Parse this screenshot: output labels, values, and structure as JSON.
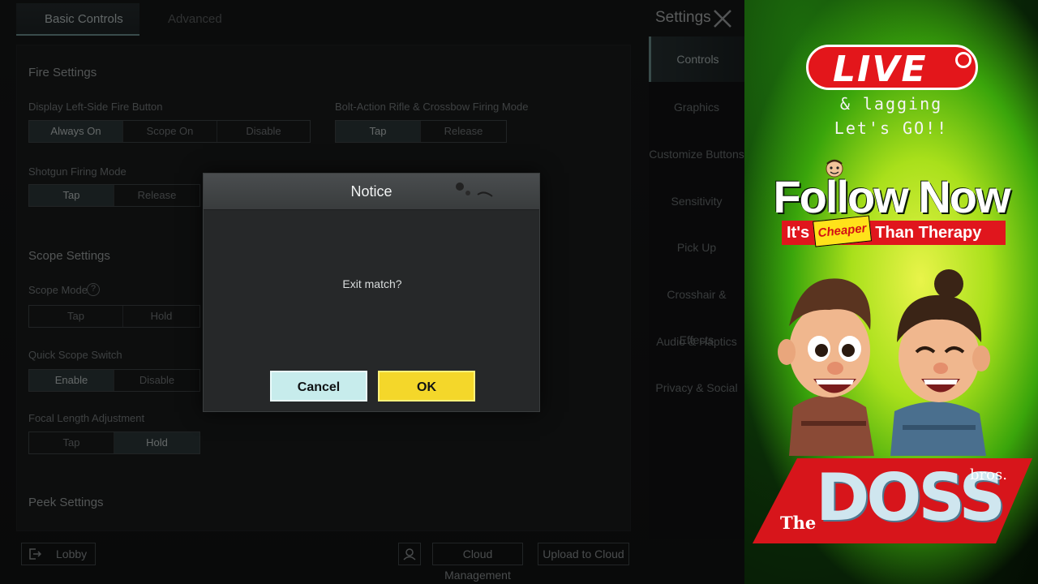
{
  "game": {
    "tabs": [
      {
        "label": "Basic Controls",
        "active": true
      },
      {
        "label": "Advanced Controls",
        "active": false
      }
    ],
    "settings_title": "Settings",
    "fire_settings": {
      "title": "Fire Settings",
      "left_fire": {
        "label": "Display Left-Side Fire Button",
        "options": [
          "Always On",
          "Scope On",
          "Disable"
        ],
        "selected": "Always On"
      },
      "bolt_action": {
        "label": "Bolt-Action Rifle & Crossbow Firing Mode",
        "options": [
          "Tap",
          "Release"
        ],
        "selected": "Tap"
      },
      "shotgun": {
        "label": "Shotgun Firing Mode",
        "options": [
          "Tap",
          "Release"
        ],
        "selected": "Tap"
      }
    },
    "scope_settings": {
      "title": "Scope Settings",
      "scope_mode": {
        "label": "Scope Mode",
        "help": "?",
        "options": [
          "Tap",
          "Hold"
        ],
        "selected": "Tap"
      },
      "quick_scope": {
        "label": "Quick Scope Switch",
        "options": [
          "Enable",
          "Disable"
        ],
        "selected": "Enable"
      },
      "focal_length": {
        "label": "Focal Length Adjustment",
        "options": [
          "Tap",
          "Hold"
        ],
        "selected": "Hold"
      }
    },
    "peek_settings": {
      "title": "Peek Settings"
    },
    "side_nav": [
      {
        "label": "Controls",
        "active": true
      },
      {
        "label": "Graphics",
        "active": false
      },
      {
        "label": "Customize Buttons",
        "active": false
      },
      {
        "label": "Sensitivity",
        "active": false
      },
      {
        "label": "Pick Up",
        "active": false
      },
      {
        "label": "Crosshair & Effects",
        "active": false
      },
      {
        "label": "Audio & Haptics",
        "active": false
      },
      {
        "label": "Privacy & Social",
        "active": false
      }
    ],
    "bottom": {
      "lobby": "Lobby",
      "cloud_management": "Cloud Management",
      "upload_to_cloud": "Upload to Cloud"
    }
  },
  "dialog": {
    "title": "Notice",
    "message": "Exit match?",
    "cancel": "Cancel",
    "ok": "OK"
  },
  "overlay": {
    "live": "LIVE",
    "line1": "& lagging",
    "line2": "Let's GO!!",
    "follow": "Follow Now",
    "tag_pre": "It's",
    "tag_cheap": "Cheaper",
    "tag_post": "Than Therapy",
    "brand_the": "The",
    "brand_name": "DOSS",
    "brand_bros": "bros."
  },
  "colors": {
    "ok_yellow": "#f4d72a",
    "cancel_cyan": "#c7ecec",
    "live_red": "#e3161b",
    "overlay_green": "#a9e01b"
  }
}
